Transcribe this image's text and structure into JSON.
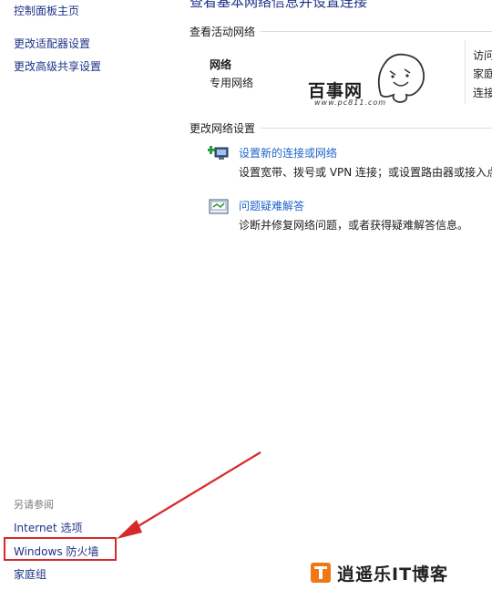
{
  "sidebar": {
    "home": "控制面板主页",
    "links": [
      "更改适配器设置",
      "更改高级共享设置"
    ],
    "see_also_title": "另请参阅",
    "see_also": [
      "Internet 选项",
      "Windows 防火墙",
      "家庭组"
    ]
  },
  "main": {
    "heading": "查看基本网络信息并设置连接",
    "active_network_title": "查看活动网络",
    "network": {
      "name": "网络",
      "type": "专用网络",
      "right_labels": [
        "访问",
        "家庭",
        "连接"
      ]
    },
    "change_settings_title": "更改网络设置",
    "tasks": [
      {
        "icon": "new-connection-icon",
        "title": "设置新的连接或网络",
        "desc": "设置宽带、拨号或 VPN 连接；或设置路由器或接入点"
      },
      {
        "icon": "troubleshoot-icon",
        "title": "问题疑难解答",
        "desc": "诊断并修复网络问题，或者获得疑难解答信息。"
      }
    ]
  },
  "watermarks": {
    "top_text": "百事网",
    "top_url": "www.pc811.com",
    "bottom_text": "逍遥乐IT博客"
  },
  "colors": {
    "link": "#1e3287",
    "task_link": "#1e64c8",
    "highlight": "#d62a2a",
    "arrow": "#d62a2a",
    "brand_orange": "#f07814"
  }
}
